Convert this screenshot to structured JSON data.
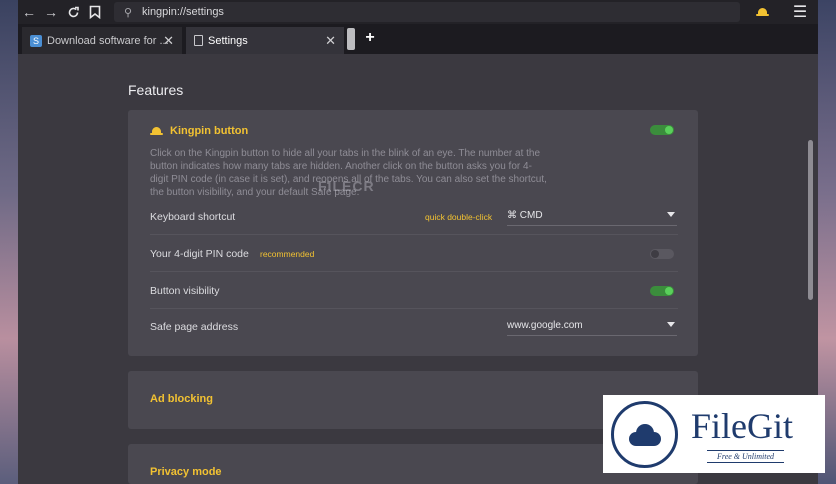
{
  "toolbar": {
    "back_icon": "arrow-left-icon",
    "forward_icon": "arrow-right-icon",
    "reload_icon": "reload-icon",
    "bookmark_icon": "bookmark-icon",
    "url": "kingpin://settings",
    "menu_icon": "hamburger-icon"
  },
  "tabs": [
    {
      "label": "Download software for ...",
      "active": false
    },
    {
      "label": "Settings",
      "active": true
    }
  ],
  "page": {
    "section_title": "Features",
    "kingpin": {
      "title": "Kingpin button",
      "description": "Click on the Kingpin button to hide all your tabs in the blink of an eye. The number at the button indicates how many tabs are hidden. Another click on the button asks you for 4-digit PIN code (in case it is set), and reopens all of the tabs. You can also set the shortcut, the button visibility, and your default Safe page.",
      "enabled": true,
      "shortcut_label": "Keyboard shortcut",
      "shortcut_hint": "quick double-click",
      "shortcut_value": "⌘ CMD",
      "pin_label": "Your 4-digit PIN code",
      "pin_badge": "recommended",
      "pin_enabled": false,
      "visibility_label": "Button visibility",
      "visibility_enabled": true,
      "safe_page_label": "Safe page address",
      "safe_page_value": "www.google.com"
    },
    "ad_blocking": {
      "title": "Ad blocking"
    },
    "privacy": {
      "title": "Privacy mode"
    }
  },
  "watermarks": {
    "center": "FILECR",
    "brand": "FileGit",
    "tagline": "Free & Unlimited"
  },
  "colors": {
    "accent": "#f2c232",
    "toggle_on": "#3b8d3c",
    "brand": "#1f3b6d"
  }
}
